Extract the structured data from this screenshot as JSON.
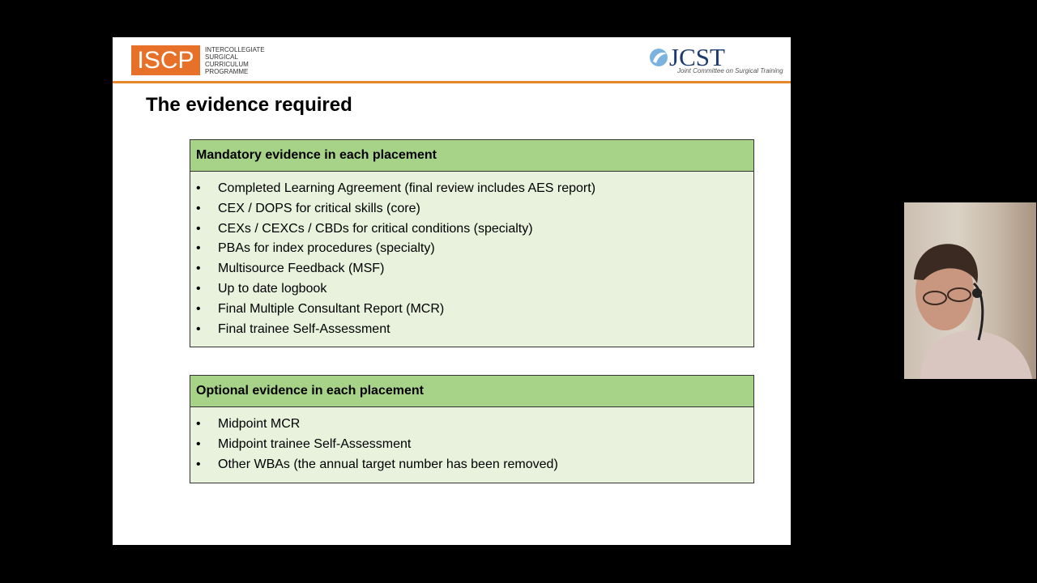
{
  "header": {
    "iscp_logo": {
      "acronym": "ISCP",
      "lines": [
        "INTERCOLLEGIATE",
        "SURGICAL",
        "CURRICULUM",
        "PROGRAMME"
      ]
    },
    "jcst_logo": {
      "acronym": "JCST",
      "subtitle": "Joint Committee on Surgical Training"
    }
  },
  "slide": {
    "title": "The evidence required",
    "mandatory": {
      "heading": "Mandatory evidence in each placement",
      "items": [
        "Completed Learning Agreement (final review includes AES report)",
        "CEX / DOPS for critical skills (core)",
        "CEXs / CEXCs / CBDs for critical conditions (specialty)",
        "PBAs for index procedures (specialty)",
        "Multisource Feedback (MSF)",
        "Up to date logbook",
        "Final Multiple Consultant Report (MCR)",
        "Final trainee Self-Assessment"
      ]
    },
    "optional": {
      "heading": "Optional evidence in each placement",
      "items": [
        "Midpoint MCR",
        "Midpoint trainee Self-Assessment",
        "Other WBAs (the annual target number has been removed)"
      ]
    }
  },
  "colors": {
    "accent_orange": "#e8712a",
    "box_header_green": "#a6d388",
    "box_body_green": "#e8f2dd",
    "jcst_navy": "#1d3a6e"
  }
}
